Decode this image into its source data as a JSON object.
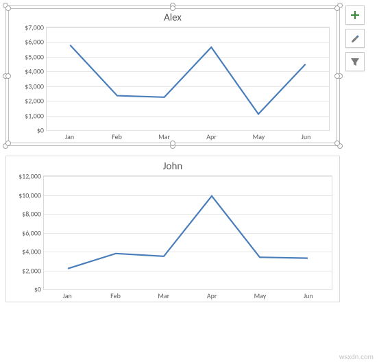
{
  "chart_data": [
    {
      "type": "line",
      "title": "Alex",
      "xlabel": "",
      "ylabel": "",
      "ylim": [
        0,
        7000
      ],
      "yticks": [
        "$0",
        "$1,000",
        "$2,000",
        "$3,000",
        "$4,000",
        "$5,000",
        "$6,000",
        "$7,000"
      ],
      "categories": [
        "Jan",
        "Feb",
        "Mar",
        "Apr",
        "May",
        "Jun"
      ],
      "values": [
        5800,
        2350,
        2250,
        5650,
        1100,
        4500
      ]
    },
    {
      "type": "line",
      "title": "John",
      "xlabel": "",
      "ylabel": "",
      "ylim": [
        0,
        12000
      ],
      "yticks": [
        "$0",
        "$2,000",
        "$4,000",
        "$6,000",
        "$8,000",
        "$10,000",
        "$12,000"
      ],
      "categories": [
        "Jan",
        "Feb",
        "Mar",
        "Apr",
        "May",
        "Jun"
      ],
      "values": [
        2200,
        3800,
        3500,
        9900,
        3400,
        3300
      ]
    }
  ],
  "buttons": {
    "add": "+",
    "brush": "brush",
    "filter": "filter"
  },
  "watermark": "wsxdn.com"
}
